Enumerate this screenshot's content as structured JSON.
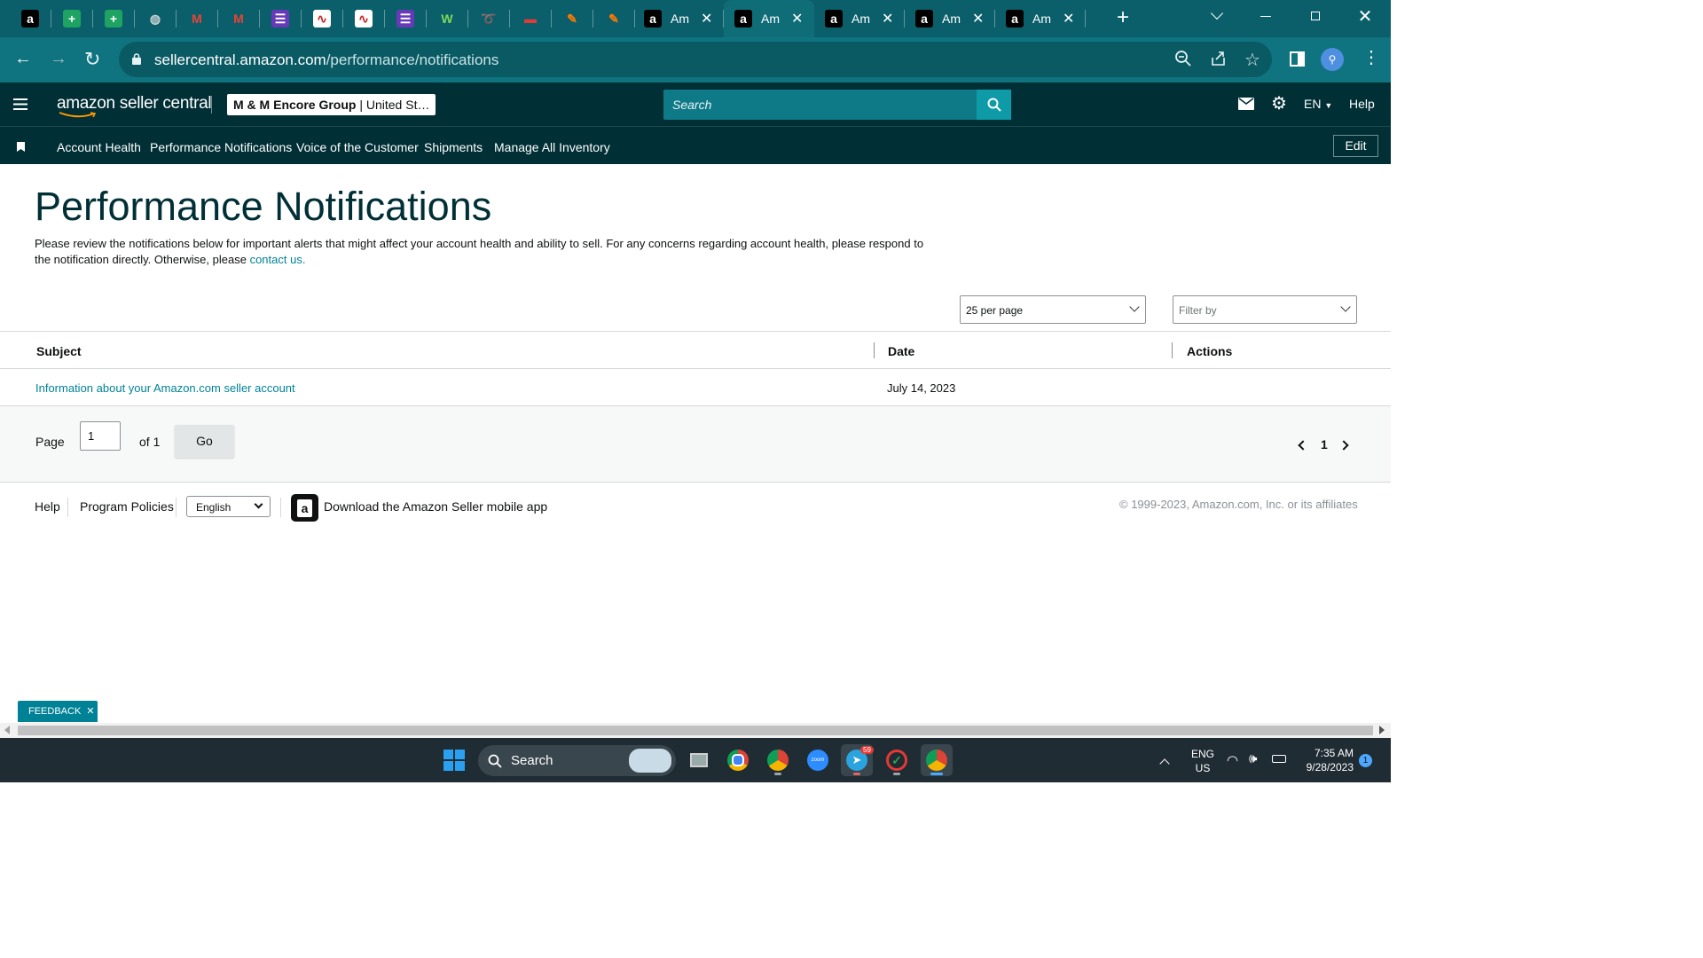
{
  "browser": {
    "tabs": [
      {
        "icon": "amazon-icon",
        "title": ""
      },
      {
        "icon": "sheets-plus-icon",
        "title": ""
      },
      {
        "icon": "sheets-plus-icon",
        "title": ""
      },
      {
        "icon": "globe-icon",
        "title": ""
      },
      {
        "icon": "gmail-icon",
        "title": ""
      },
      {
        "icon": "gmail-icon",
        "title": ""
      },
      {
        "icon": "list-icon",
        "title": ""
      },
      {
        "icon": "chart-doc-icon",
        "title": ""
      },
      {
        "icon": "chart-doc-icon",
        "title": ""
      },
      {
        "icon": "list-icon",
        "title": ""
      },
      {
        "icon": "w-logo-icon",
        "title": ""
      },
      {
        "icon": "red-swirl-icon",
        "title": ""
      },
      {
        "icon": "red-logo-icon",
        "title": ""
      },
      {
        "icon": "pencil-tag-icon",
        "title": ""
      },
      {
        "icon": "pencil-tag-icon",
        "title": ""
      },
      {
        "icon": "amazon-icon",
        "title": "Am"
      },
      {
        "icon": "amazon-icon",
        "title": "Am",
        "active": true
      },
      {
        "icon": "amazon-icon",
        "title": "Am"
      },
      {
        "icon": "amazon-icon",
        "title": "Am"
      },
      {
        "icon": "amazon-icon",
        "title": "Am"
      }
    ],
    "url_domain": "sellercentral.amazon.com",
    "url_path": "/performance/notifications"
  },
  "header": {
    "logo": "amazon seller central",
    "store_name": "M & M Encore Group",
    "store_region": "United St…",
    "search_placeholder": "Search",
    "language": "EN",
    "help": "Help"
  },
  "nav": {
    "links": [
      "Account Health",
      "Performance Notifications",
      "Voice of the Customer",
      "Shipments",
      "Manage All Inventory"
    ],
    "edit": "Edit"
  },
  "page": {
    "title": "Performance Notifications",
    "intro_text": "Please review the notifications below for important alerts that might affect your account health and ability to sell. For any concerns regarding account health, please respond to the notification directly. Otherwise, please",
    "intro_link": "contact us.",
    "per_page": "25 per page",
    "filter_placeholder": "Filter by"
  },
  "table": {
    "headers": {
      "subject": "Subject",
      "date": "Date",
      "actions": "Actions"
    },
    "rows": [
      {
        "subject": "Information about your Amazon.com seller account",
        "date": "July 14, 2023",
        "actions": ""
      }
    ]
  },
  "pager": {
    "page_label": "Page",
    "page_value": "1",
    "of_label": "of 1",
    "go": "Go",
    "current": "1"
  },
  "footer": {
    "help": "Help",
    "policies": "Program Policies",
    "language": "English",
    "app_text": "Download the Amazon Seller mobile app",
    "copyright": "© 1999-2023, Amazon.com, Inc. or its affiliates"
  },
  "feedback": {
    "label": "FEEDBACK"
  },
  "taskbar": {
    "search": "Search",
    "lang1": "ENG",
    "lang2": "US",
    "time": "7:35 AM",
    "date": "9/28/2023",
    "telegram_badge": "59",
    "notif_count": "1"
  },
  "colors": {
    "brand_dark": "#002f36",
    "teal_link": "#008296",
    "chrome_teal": "#0b5f6b"
  }
}
